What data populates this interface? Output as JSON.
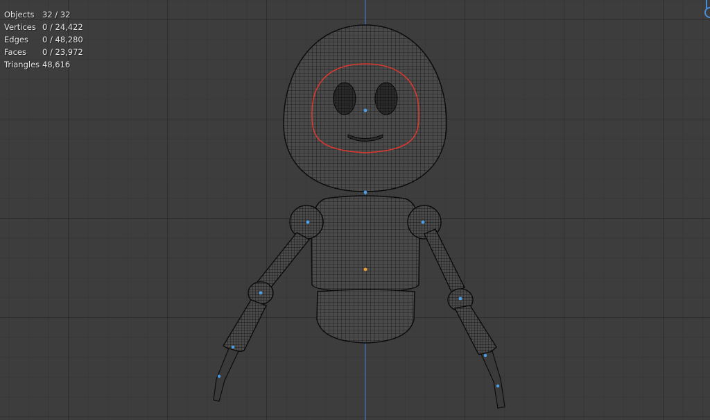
{
  "statistics": {
    "rows": [
      {
        "label": "Objects",
        "value": "32 / 32"
      },
      {
        "label": "Vertices",
        "value": "0 / 24,422"
      },
      {
        "label": "Edges",
        "value": "0 / 48,280"
      },
      {
        "label": "Faces",
        "value": "0 / 23,972"
      },
      {
        "label": "Triangles",
        "value": "48,616"
      }
    ]
  },
  "colors": {
    "background": "#3d3d3d",
    "wire": "#0c0c0c",
    "axis": "#4c8ddb",
    "selection_outline": "#d8382f",
    "origin_dot": "#4c9fe8",
    "active_origin": "#f0a030"
  }
}
